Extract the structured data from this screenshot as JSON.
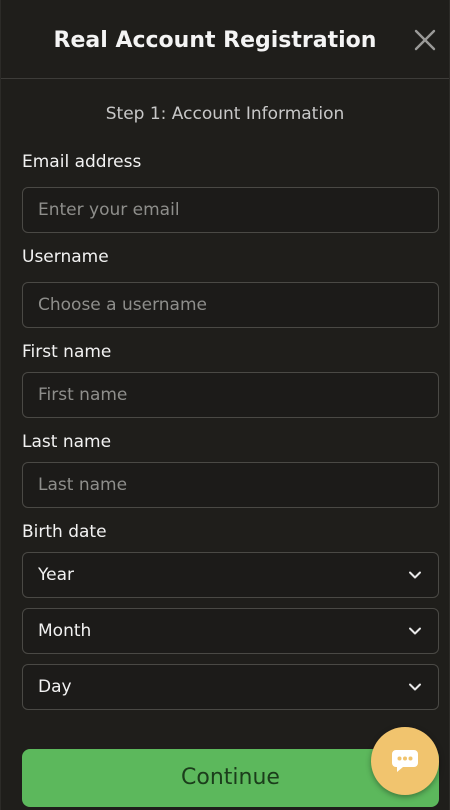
{
  "header": {
    "title": "Real Account Registration",
    "close_icon": "close-icon"
  },
  "step_text": "Step 1: Account Information",
  "fields": {
    "email": {
      "label": "Email address",
      "placeholder": "Enter your email",
      "value": ""
    },
    "username": {
      "label": "Username",
      "placeholder": "Choose a username",
      "value": ""
    },
    "first_name": {
      "label": "First name",
      "placeholder": "First name",
      "value": ""
    },
    "last_name": {
      "label": "Last name",
      "placeholder": "Last name",
      "value": ""
    }
  },
  "birth_date": {
    "label": "Birth date",
    "year": "Year",
    "month": "Month",
    "day": "Day"
  },
  "continue_label": "Continue",
  "chat_icon": "chat-bubble-icon",
  "colors": {
    "background": "#1f1e1b",
    "primary_button": "#5cb85c",
    "chat_button": "#f1c46e"
  }
}
